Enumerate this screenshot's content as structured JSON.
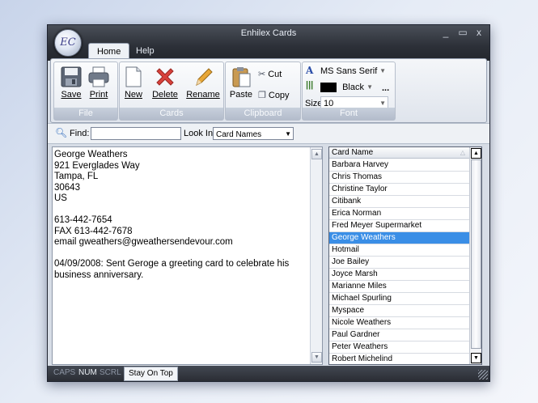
{
  "window": {
    "title": "Enhilex Cards",
    "minimize": "_",
    "maximize": "▭",
    "close": "x",
    "orb_text": "EC"
  },
  "tabs": [
    "Home",
    "Help"
  ],
  "ribbon": {
    "file": {
      "label": "File",
      "save": "Save",
      "print": "Print"
    },
    "cards": {
      "label": "Cards",
      "new": "New",
      "delete": "Delete",
      "rename": "Rename"
    },
    "clipboard": {
      "label": "Clipboard",
      "paste": "Paste",
      "cut": "Cut",
      "copy": "Copy"
    },
    "font": {
      "label": "Font",
      "font_name": "MS Sans Serif",
      "color_name": "Black",
      "size_label": "Size",
      "size_value": "10",
      "more": "..."
    }
  },
  "find": {
    "label": "Find:",
    "value": "",
    "look_in_label": "Look In:",
    "look_in_value": "Card Names"
  },
  "card_text": [
    "George Weathers",
    "921 Everglades Way",
    "Tampa, FL",
    "30643",
    "US",
    "",
    "613-442-7654",
    "FAX 613-442-7678",
    "email gweathers@gweathersendevour.com",
    "",
    "04/09/2008: Sent Geroge a greeting card to celebrate his",
    "business anniversary."
  ],
  "card_list": {
    "header": "Card Name",
    "selected_index": 6,
    "items": [
      "Barbara Harvey",
      "Chris Thomas",
      "Christine Taylor",
      "Citibank",
      "Erica Norman",
      "Fred Meyer Supermarket",
      "George Weathers",
      "Hotmail",
      "Joe Bailey",
      "Joyce Marsh",
      "Marianne Miles",
      "Michael Spurling",
      "Myspace",
      "Nicole Weathers",
      "Paul Gardner",
      "Peter Weathers",
      "Robert Michelind"
    ]
  },
  "status": {
    "caps": "CAPS",
    "num": "NUM",
    "scrl": "SCRL",
    "stay_on_top": "Stay On Top"
  },
  "colors": {
    "accent_selection": "#3a8ee6",
    "title_bar": "#2c3038",
    "delete_red": "#d8413b"
  }
}
